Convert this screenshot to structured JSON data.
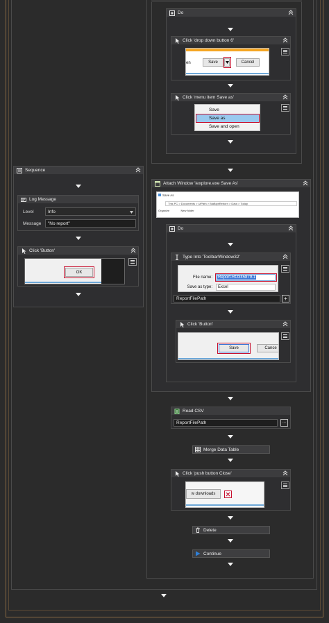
{
  "do_top": {
    "title": "Do"
  },
  "click_dropdown": {
    "title": "Click 'drop down button  6'",
    "shot_left_text": "en",
    "save_label": "Save",
    "cancel_label": "Cancel"
  },
  "click_menu_save_as": {
    "title": "Click 'menu item  Save as'",
    "items": [
      "Save",
      "Save as",
      "Save and open"
    ]
  },
  "sequence": {
    "title": "Sequence",
    "log_message": {
      "title": "Log Message",
      "level_label": "Level",
      "level_value": "Info",
      "message_label": "Message",
      "message_value": "\"No report\""
    },
    "click_button": {
      "title": "Click 'Button'",
      "ok_label": "OK"
    }
  },
  "attach_window": {
    "title": "Attach Window 'iexplore.exe  Save As'",
    "shot_title": "Save As",
    "shot_path": "This PC  >  Documents  >  UiPath  >  BlaBlyaReborn  >  Data  >  Today",
    "shot_organize": "Organize",
    "shot_new_folder": "New folder"
  },
  "do_inner": {
    "title": "Do"
  },
  "type_into": {
    "title": "Type Into 'ToolbarWindow32'",
    "file_name_label": "File name:",
    "file_name_value": "Report-RO345879-1",
    "save_as_type_label": "Save as type:",
    "save_as_type_value": "Excel",
    "input_value": "ReportFilePath"
  },
  "click_save_button": {
    "title": "Click 'Button'",
    "save_label": "Save",
    "cancel_label": "Cance"
  },
  "read_csv": {
    "title": "Read CSV",
    "input_value": "ReportFilePath"
  },
  "merge_data_table": {
    "title": "Merge Data Table"
  },
  "click_close": {
    "title": "Click 'push button  Close'",
    "downloads_label": "w downloads"
  },
  "delete": {
    "title": "Delete"
  },
  "continue": {
    "title": "Continue"
  },
  "colors": {
    "background": "#2b2b2b",
    "activity_header": "#3c3c3e",
    "highlight_red": "#c8102e",
    "selection_blue": "#99c9ef",
    "frame_brown": "#8a6a44"
  }
}
